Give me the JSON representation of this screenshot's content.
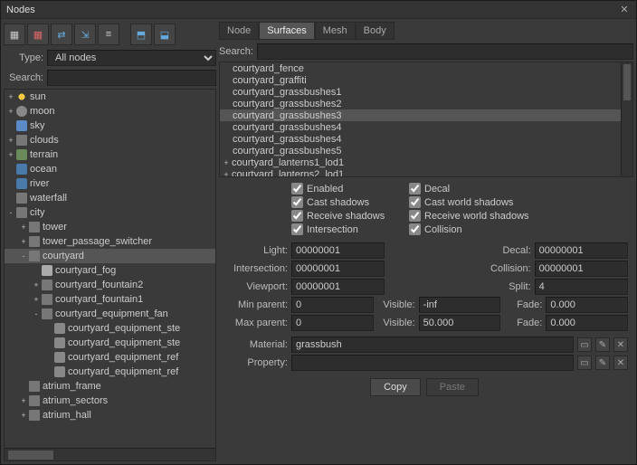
{
  "window": {
    "title": "Nodes"
  },
  "left": {
    "type_label": "Type:",
    "type_value": "All nodes",
    "search_label": "Search:",
    "search_value": "",
    "tree": [
      {
        "d": 0,
        "tw": "+",
        "ic": "sun",
        "t": "sun"
      },
      {
        "d": 0,
        "tw": "+",
        "ic": "moon",
        "t": "moon"
      },
      {
        "d": 0,
        "tw": "",
        "ic": "sky",
        "t": "sky"
      },
      {
        "d": 0,
        "tw": "+",
        "ic": "folder",
        "t": "clouds"
      },
      {
        "d": 0,
        "tw": "+",
        "ic": "terrain",
        "t": "terrain"
      },
      {
        "d": 0,
        "tw": "",
        "ic": "water",
        "t": "ocean"
      },
      {
        "d": 0,
        "tw": "",
        "ic": "water",
        "t": "river"
      },
      {
        "d": 0,
        "tw": "",
        "ic": "folder",
        "t": "waterfall"
      },
      {
        "d": 0,
        "tw": "-",
        "ic": "folder",
        "t": "city"
      },
      {
        "d": 1,
        "tw": "+",
        "ic": "folder",
        "t": "tower"
      },
      {
        "d": 1,
        "tw": "+",
        "ic": "folder",
        "t": "tower_passage_switcher"
      },
      {
        "d": 1,
        "tw": "-",
        "ic": "folder",
        "t": "courtyard",
        "sel": true
      },
      {
        "d": 2,
        "tw": "",
        "ic": "fog",
        "t": "courtyard_fog"
      },
      {
        "d": 2,
        "tw": "+",
        "ic": "folder",
        "t": "courtyard_fountain2"
      },
      {
        "d": 2,
        "tw": "+",
        "ic": "folder",
        "t": "courtyard_fountain1"
      },
      {
        "d": 2,
        "tw": "-",
        "ic": "folder",
        "t": "courtyard_equipment_fan"
      },
      {
        "d": 3,
        "tw": "",
        "ic": "mesh",
        "t": "courtyard_equipment_ste"
      },
      {
        "d": 3,
        "tw": "",
        "ic": "mesh",
        "t": "courtyard_equipment_ste"
      },
      {
        "d": 3,
        "tw": "",
        "ic": "mesh",
        "t": "courtyard_equipment_ref"
      },
      {
        "d": 3,
        "tw": "",
        "ic": "mesh",
        "t": "courtyard_equipment_ref"
      },
      {
        "d": 1,
        "tw": "",
        "ic": "folder",
        "t": "atrium_frame"
      },
      {
        "d": 1,
        "tw": "+",
        "ic": "folder",
        "t": "atrium_sectors"
      },
      {
        "d": 1,
        "tw": "+",
        "ic": "folder",
        "t": "atrium_hall"
      }
    ]
  },
  "right": {
    "tabs": [
      "Node",
      "Surfaces",
      "Mesh",
      "Body"
    ],
    "active_tab": 1,
    "search_label": "Search:",
    "search_value": "",
    "list": [
      {
        "t": "courtyard_fence"
      },
      {
        "t": "courtyard_graffiti"
      },
      {
        "t": "courtyard_grassbushes1"
      },
      {
        "t": "courtyard_grassbushes2"
      },
      {
        "t": "courtyard_grassbushes3",
        "sel": true
      },
      {
        "t": "courtyard_grassbushes4"
      },
      {
        "t": "courtyard_grassbushes4"
      },
      {
        "t": "courtyard_grassbushes5"
      },
      {
        "t": "courtyard_lanterns1_lod1",
        "tw": "+"
      },
      {
        "t": "courtyard_lanterns2_lod1",
        "tw": "+"
      }
    ],
    "checks": {
      "enabled": "Enabled",
      "decal": "Decal",
      "cast_shadows": "Cast shadows",
      "cast_world_shadows": "Cast world shadows",
      "receive_shadows": "Receive shadows",
      "receive_world_shadows": "Receive world shadows",
      "intersection": "Intersection",
      "collision": "Collision"
    },
    "labels": {
      "light": "Light:",
      "decal": "Decal:",
      "intersection": "Intersection:",
      "collision": "Collision:",
      "viewport": "Viewport:",
      "split": "Split:",
      "min_parent": "Min parent:",
      "max_parent": "Max parent:",
      "visible": "Visible:",
      "fade": "Fade:",
      "material": "Material:",
      "property": "Property:"
    },
    "values": {
      "light": "00000001",
      "decal": "00000001",
      "intersection": "00000001",
      "collision": "00000001",
      "viewport": "00000001",
      "split": "4",
      "min_parent": "0",
      "max_parent": "0",
      "visible_min": "-inf",
      "visible_max": "50.000",
      "fade_min": "0.000",
      "fade_max": "0.000",
      "material": "grassbush",
      "property": ""
    },
    "buttons": {
      "copy": "Copy",
      "paste": "Paste"
    }
  }
}
